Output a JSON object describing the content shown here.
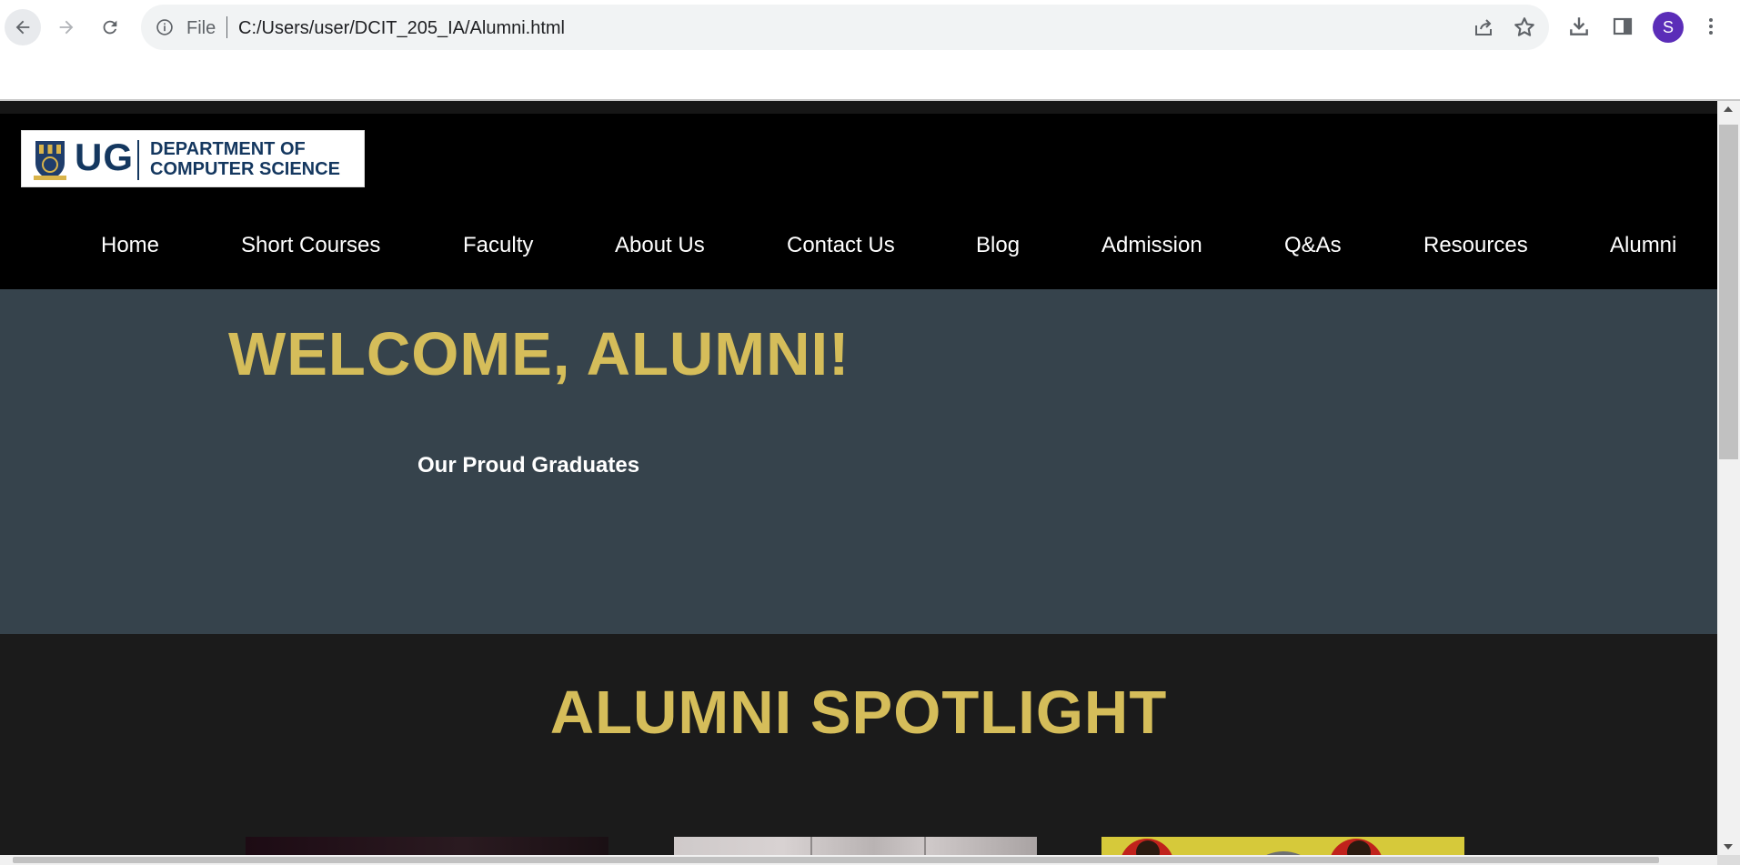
{
  "browser": {
    "omnibox": {
      "scheme_label": "File",
      "url": "C:/Users/user/DCIT_205_IA/Alumni.html"
    },
    "profile_initial": "S",
    "icons": [
      "back-icon",
      "forward-icon",
      "reload-icon",
      "info-icon",
      "share-icon",
      "star-icon",
      "download-icon",
      "side-panel-icon",
      "more-icon"
    ]
  },
  "site": {
    "logo": {
      "short": "UG",
      "dept_line1": "DEPARTMENT OF",
      "dept_line2": "COMPUTER SCIENCE"
    },
    "menu": [
      "Home",
      "Short Courses",
      "Faculty",
      "About Us",
      "Contact Us",
      "Blog",
      "Admission",
      "Q&As",
      "Resources",
      "Alumni"
    ],
    "welcome": {
      "title": "WELCOME, ALUMNI!",
      "subtitle": "Our Proud Graduates"
    },
    "spotlight": {
      "title": "ALUMNI SPOTLIGHT"
    },
    "colors": {
      "gold": "#d5bd5a",
      "header_bg": "#000000",
      "welcome_bg": "#36434c",
      "spotlight_bg": "#1b1b1b",
      "logo_navy": "#14375f"
    }
  }
}
